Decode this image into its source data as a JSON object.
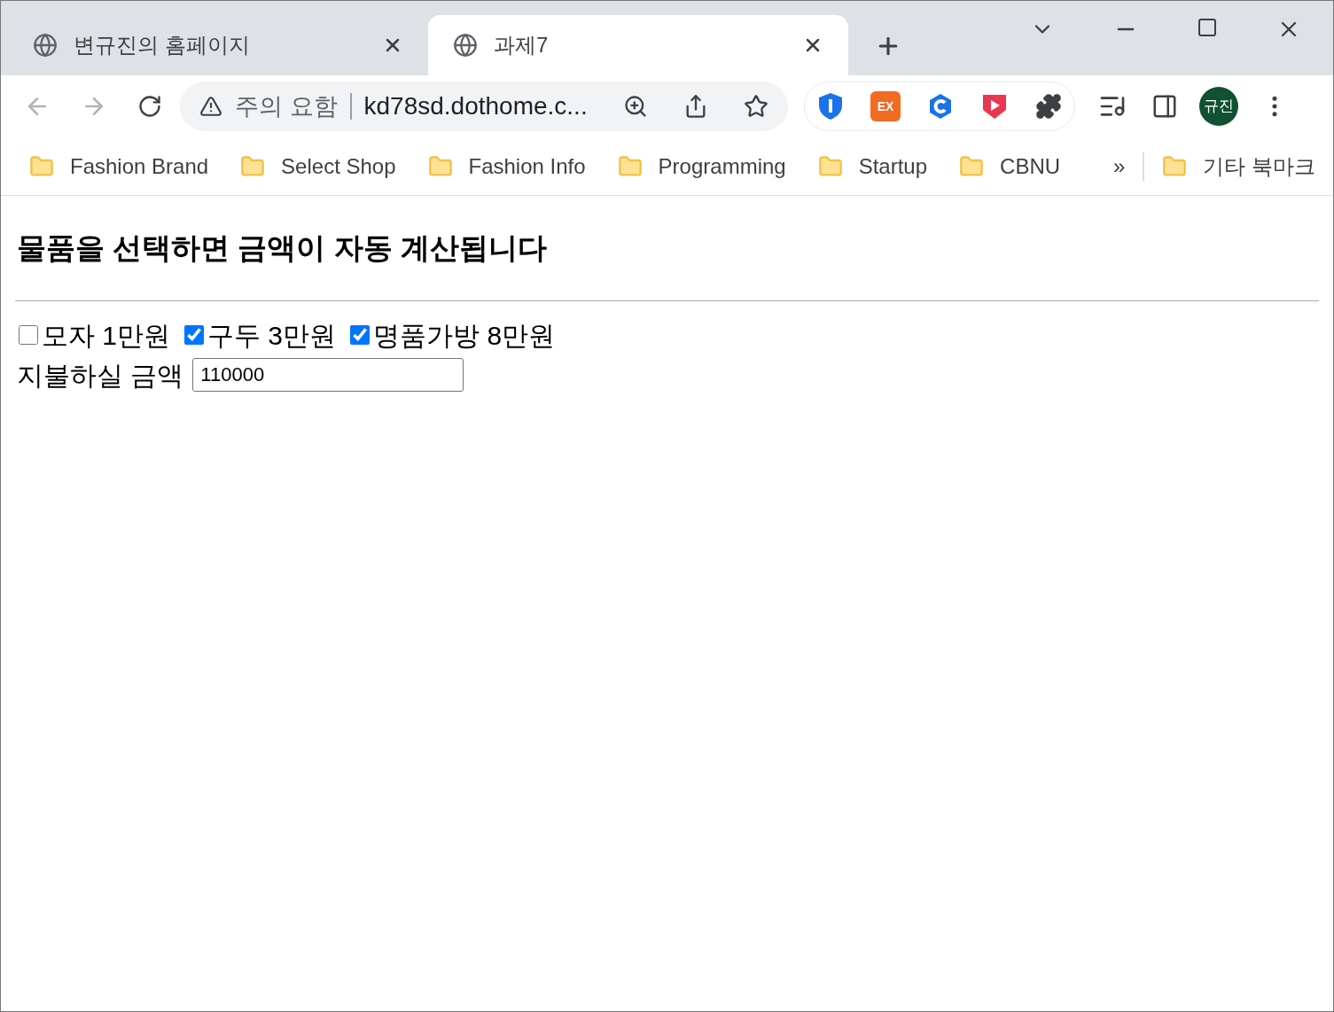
{
  "tabs": [
    {
      "title": "변규진의 홈페이지",
      "selected": false
    },
    {
      "title": "과제7",
      "selected": true
    }
  ],
  "address_bar": {
    "warning": "주의 요함",
    "url": "kd78sd.dothome.c..."
  },
  "extensions": {
    "ex_label": "EX"
  },
  "profile": {
    "initials": "규진"
  },
  "bookmarks": [
    "Fashion Brand",
    "Select Shop",
    "Fashion Info",
    "Programming",
    "Startup",
    "CBNU"
  ],
  "bookmarks_overflow": "»",
  "other_bookmarks": "기타 북마크",
  "page": {
    "heading": "물품을 선택하면 금액이 자동 계산됩니다",
    "items": [
      {
        "label": "모자 1만원",
        "checked": false
      },
      {
        "label": "구두 3만원",
        "checked": true
      },
      {
        "label": "명품가방 8만원",
        "checked": true
      }
    ],
    "total_label": "지불하실 금액",
    "total_value": "110000"
  }
}
